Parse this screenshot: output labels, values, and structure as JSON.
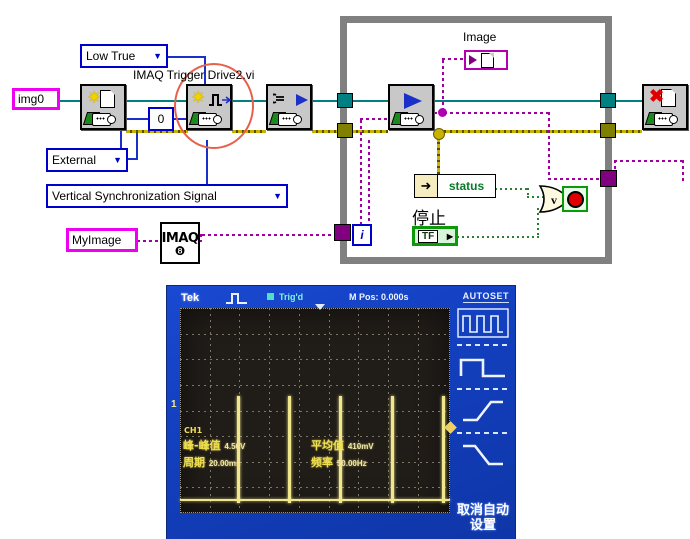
{
  "diagram": {
    "title_label": "IMAQ Trigger Drive2.vi",
    "controls": {
      "img_ref": "img0",
      "polarity": "Low True",
      "trigger_line_const": "0",
      "source": "External",
      "signal": "Vertical Synchronization Signal",
      "image_name": "MyImage",
      "imaq_create_text": "IMAQ"
    },
    "loop": {
      "image_indicator_label": "Image",
      "status_label": "status",
      "stop_label": "停止",
      "stop_button_text": "TF",
      "iteration_terminal": "i"
    },
    "colors": {
      "image_wire": "#00807f",
      "error_wire": "#c8b400",
      "pink_wire": "#cc00cc",
      "loop_border": "#808080",
      "enum_border": "#0000cd",
      "control_pink": "#f000f0",
      "highlight_circle": "#e8604c"
    }
  },
  "scope": {
    "brand": "Tek",
    "trigger_status": "Trig'd",
    "horizontal_position": "M Pos: 0.000s",
    "menu_title": "AUTOSET",
    "cancel_label": "取消自动设置",
    "channel_marker": "1",
    "channel_label": "CH1",
    "measurements": [
      {
        "name": "峰-峰值",
        "value": "4.56V"
      },
      {
        "name": "平均值",
        "value": "410mV"
      },
      {
        "name": "周期",
        "value": "20.00ms"
      },
      {
        "name": "频率",
        "value": "50.00Hz"
      }
    ],
    "waveform": {
      "description": "narrow positive pulses on a low baseline",
      "pulse_count": 5,
      "pulse_x_percent": [
        21,
        40,
        59,
        78,
        97
      ],
      "baseline_y_percent": 96,
      "pulse_height_percent": 52
    }
  }
}
